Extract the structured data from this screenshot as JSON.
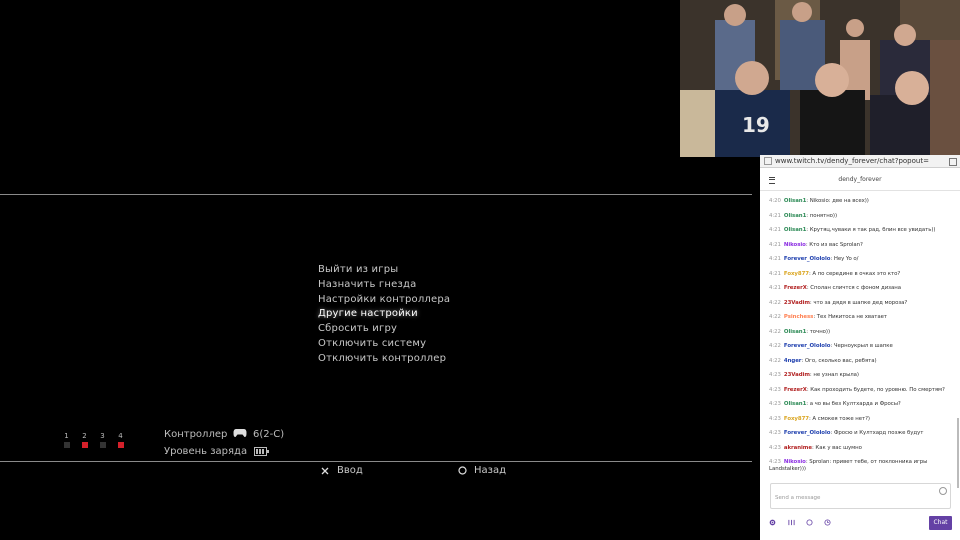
{
  "menu": {
    "items": [
      {
        "label": "Выйти из игры"
      },
      {
        "label": "Назначить гнезда"
      },
      {
        "label": "Настройки контроллера"
      },
      {
        "label": "Другие настройки"
      },
      {
        "label": "Сбросить игру"
      },
      {
        "label": "Отключить систему"
      },
      {
        "label": "Отключить контроллер"
      }
    ],
    "selected_label": "Другие настройки"
  },
  "controller_ports": {
    "ports": [
      "1",
      "2",
      "3",
      "4"
    ],
    "active": [
      "2",
      "4"
    ]
  },
  "controller_info": {
    "controller_label": "Контроллер",
    "controller_value": "6(2-C)",
    "battery_label": "Уровень заряда",
    "battery_level": 1.0
  },
  "hints": {
    "enter": "Ввод",
    "back": "Назад"
  },
  "colors": {
    "twitch_purple": "#6441a5",
    "port_active": "#d4202a"
  },
  "browser": {
    "url": "www.twitch.tv/dendy_forever/chat?popout="
  },
  "chat": {
    "channel": "dendy_forever",
    "messages": [
      {
        "time": "4:20",
        "user": "Olisan1",
        "color": "#2e8b57",
        "text": "Nikosio: две на всех))"
      },
      {
        "time": "4:21",
        "user": "Olisan1",
        "color": "#2e8b57",
        "text": "понятно))"
      },
      {
        "time": "4:21",
        "user": "Olisan1",
        "color": "#2e8b57",
        "text": "Крутяц,чуваки я так рад, блин все увидать))"
      },
      {
        "time": "4:21",
        "user": "Nikosio",
        "color": "#8a2be2",
        "text": "Кто из вас Sprolan?"
      },
      {
        "time": "4:21",
        "user": "Forever_Olololo",
        "color": "#1e3fae",
        "text": "Hey Yo o/"
      },
      {
        "time": "4:21",
        "user": "Foxy877",
        "color": "#daa520",
        "text": "А по середине в очках это кто?"
      },
      {
        "time": "4:21",
        "user": "FrezerX",
        "color": "#b22222",
        "text": "Сполан сличтся с фоном дизана"
      },
      {
        "time": "4:22",
        "user": "23Vadim",
        "color": "#b22222",
        "text": "что за дядя в шапке дед мороза?"
      },
      {
        "time": "4:22",
        "user": "Psinchess",
        "color": "#ff7f50",
        "text": "Тех Никитоса не хватает"
      },
      {
        "time": "4:22",
        "user": "Olisan1",
        "color": "#2e8b57",
        "text": "точно))"
      },
      {
        "time": "4:22",
        "user": "Forever_Olololo",
        "color": "#1e3fae",
        "text": "Черноукрыл в шапке"
      },
      {
        "time": "4:22",
        "user": "4nger",
        "color": "#1e3fae",
        "text": "Ого, сколько вас, ребята)"
      },
      {
        "time": "4:23",
        "user": "23Vadim",
        "color": "#b22222",
        "text": "не узнал крыла)"
      },
      {
        "time": "4:23",
        "user": "FrezerX",
        "color": "#b22222",
        "text": "Как проходить будете, по уровню. По смертям?"
      },
      {
        "time": "4:23",
        "user": "Olisan1",
        "color": "#2e8b57",
        "text": "а чо вы без Култхарда и Фросы?"
      },
      {
        "time": "4:23",
        "user": "Foxy877",
        "color": "#daa520",
        "text": "А смокея тоже нет?)"
      },
      {
        "time": "4:23",
        "user": "Forever_Olololo",
        "color": "#1e3fae",
        "text": "Фросю и Култхард позже будут"
      },
      {
        "time": "4:23",
        "user": "akranime",
        "color": "#b22222",
        "text": "Как у вас шумно"
      },
      {
        "time": "4:23",
        "user": "Nikosio",
        "color": "#8a2be2",
        "text": "Sprolan: привет тебе, от поклонника игры Landstalker)))"
      }
    ],
    "input_placeholder": "Send a message",
    "chat_button": "Chat"
  }
}
